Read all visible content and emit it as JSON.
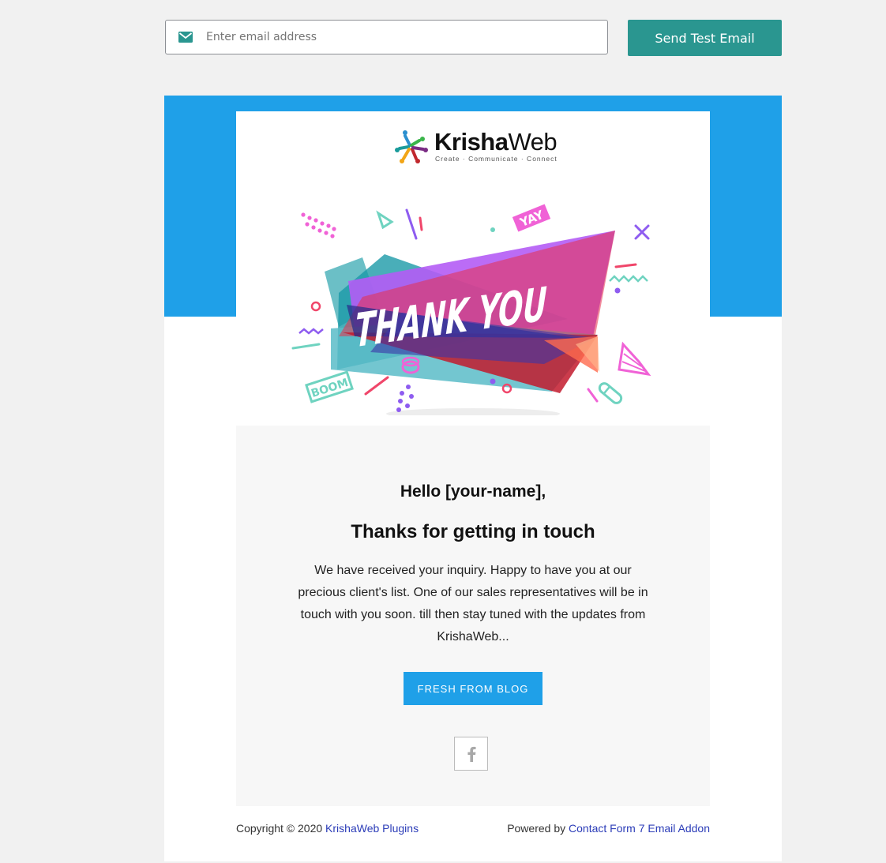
{
  "test_bar": {
    "email_placeholder": "Enter email address",
    "email_value": "",
    "send_label": "Send Test Email",
    "accent_color": "#2a9690"
  },
  "email": {
    "brand_color": "#1fa0e8",
    "logo": {
      "name_bold": "Krisha",
      "name_regular": "Web",
      "tagline": "Create · Communicate · Connect"
    },
    "hero": {
      "text": "THANK YOU",
      "stickers": [
        "YAY",
        "BOOM"
      ]
    },
    "greeting": "Hello [your-name],",
    "headline": "Thanks for getting in touch",
    "body": "We have received your inquiry. Happy to have you at our precious client's list. One of our sales representatives will be in touch with you soon. till then stay tuned with the updates from KrishaWeb...",
    "cta_label": "FRESH FROM BLOG",
    "social_icon": "facebook-icon",
    "footer": {
      "copyright_prefix": "Copyright © 2020",
      "copyright_link": "KrishaWeb Plugins",
      "powered_prefix": "Powered by",
      "powered_link": "Contact Form 7 Email Addon"
    }
  }
}
